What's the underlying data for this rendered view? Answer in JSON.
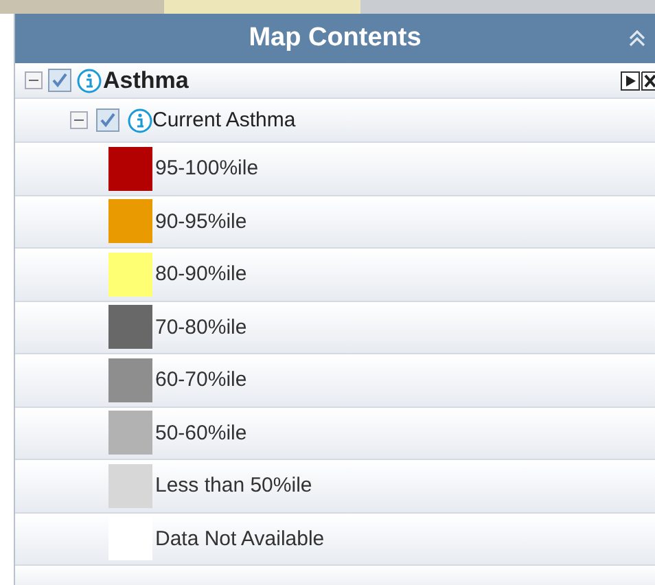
{
  "panel": {
    "title": "Map Contents"
  },
  "layers": [
    {
      "name": "Asthma",
      "checked": true,
      "expanded": true,
      "children": [
        {
          "name": "Current Asthma",
          "checked": true,
          "expanded": true,
          "legend": [
            {
              "label": "95-100%ile",
              "color": "#b30000"
            },
            {
              "label": "90-95%ile",
              "color": "#e89a00"
            },
            {
              "label": "80-90%ile",
              "color": "#ffff73"
            },
            {
              "label": "70-80%ile",
              "color": "#686868"
            },
            {
              "label": "60-70%ile",
              "color": "#8e8e8e"
            },
            {
              "label": "50-60%ile",
              "color": "#b2b2b2"
            },
            {
              "label": "Less than 50%ile",
              "color": "#d7d7d7"
            },
            {
              "label": "Data Not Available",
              "color": "#ffffff"
            }
          ]
        }
      ]
    }
  ]
}
